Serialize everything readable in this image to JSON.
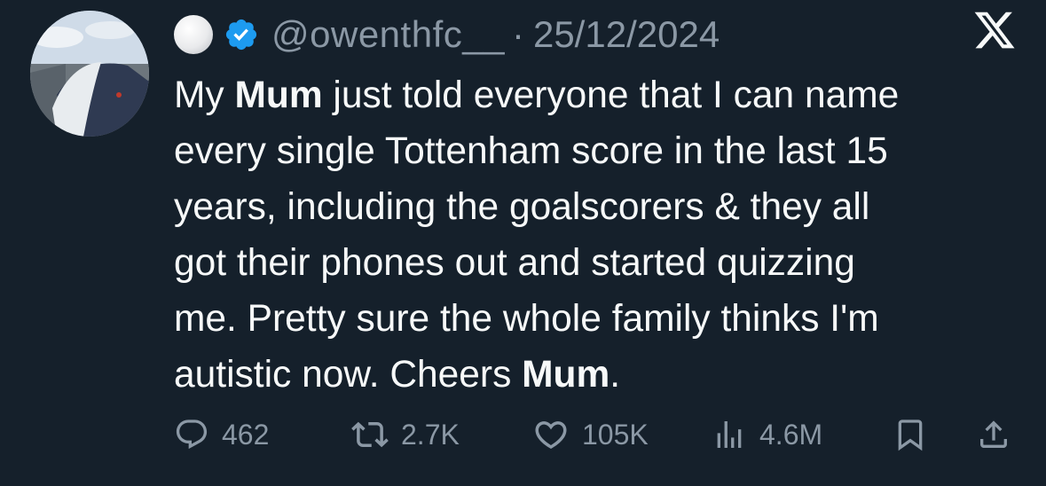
{
  "tweet": {
    "handle": "@owenthfc__",
    "separator": "·",
    "date": "25/12/2024",
    "display_name_emoji": "white-circle-emoji",
    "verified_icon": "verified-badge-icon",
    "platform_logo": "x-logo",
    "text_segments": [
      {
        "text": "My ",
        "bold": false
      },
      {
        "text": "Mum",
        "bold": true
      },
      {
        "text": " just told everyone that I can name\nevery single Tottenham score in the last 15\nyears, including the goalscorers & they all\ngot their phones out and started quizzing\nme. Pretty sure the whole family thinks I'm\nautistic now. Cheers ",
        "bold": false
      },
      {
        "text": "Mum",
        "bold": true
      },
      {
        "text": ".",
        "bold": false
      }
    ]
  },
  "actions": {
    "replies": "462",
    "reposts": "2.7K",
    "likes": "105K",
    "views": "4.6M"
  },
  "colors": {
    "background": "#15202b",
    "text": "#f7f9f9",
    "muted": "#8b98a5",
    "verified": "#1d9bf0"
  }
}
